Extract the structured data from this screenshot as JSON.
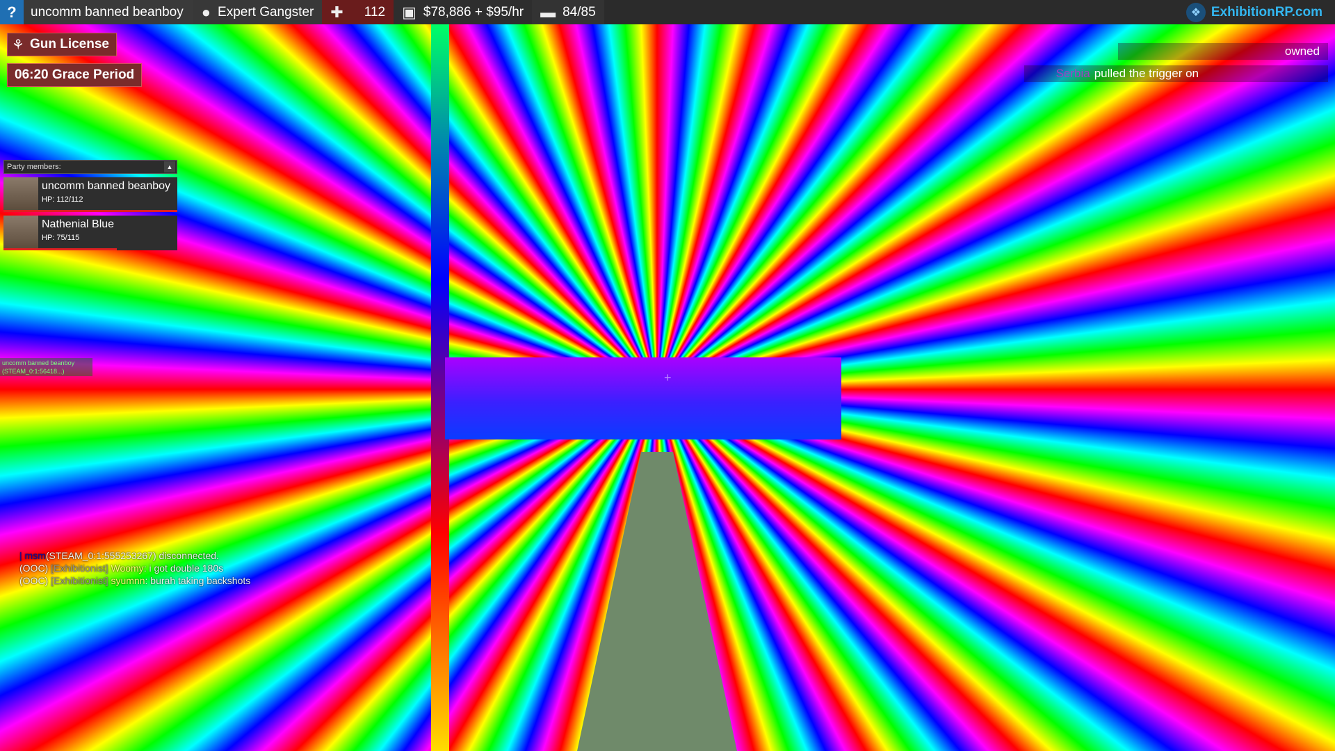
{
  "topbar": {
    "help_glyph": "?",
    "player_name": "uncomm banned beanboy",
    "job": "Expert Gangster",
    "health": "112",
    "money": "$78,886 + $95/hr",
    "hunger": "84/85",
    "brand": "ExhibitionRP.com",
    "icons": [
      "help-icon",
      "person-icon",
      "health-cross-icon",
      "wallet-icon",
      "hunger-icon",
      "logo-icon"
    ]
  },
  "licenses": {
    "gun_license": "Gun License",
    "grace_period": "06:20 Grace Period"
  },
  "party": {
    "header": "Party members:",
    "toggle": "▲",
    "members": [
      {
        "name": "uncomm banned beanboy",
        "hp": "HP: 112/112",
        "hp_fraction": 1.0
      },
      {
        "name": "Nathenial Blue",
        "hp": "HP: 75/115",
        "hp_fraction": 0.65
      }
    ]
  },
  "world_tag": {
    "line1": "uncomm banned beanboy",
    "line2": "(STEAM_0:1:56418...)"
  },
  "killfeed": [
    {
      "left": "",
      "action": "owned",
      "right": ""
    },
    {
      "left": "Serbia",
      "action": "pulled the trigger on",
      "right": ""
    }
  ],
  "chat": [
    {
      "prefix": "| ",
      "name": "msm",
      "rest": "(STEAM_0:1:555253267) disconnected."
    },
    {
      "prefix": "(OOC) ",
      "tag": "[Exhibitionist]",
      "name": " Woomy",
      "rest": ": i got double 180s"
    },
    {
      "prefix": "(OOC) ",
      "tag": "[Exhibitionist]",
      "name": " syumnn",
      "rest": ": burah taking backshots"
    }
  ]
}
